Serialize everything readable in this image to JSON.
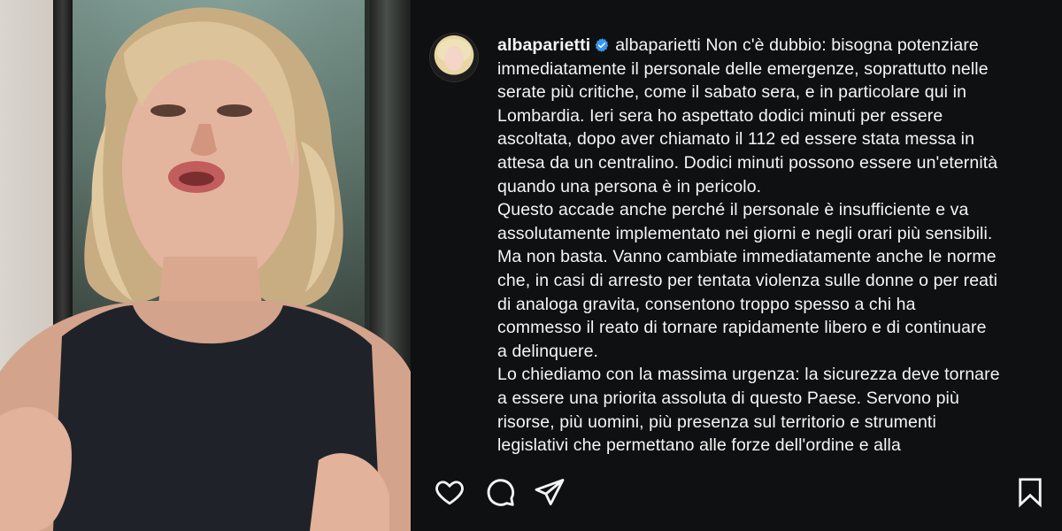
{
  "post": {
    "username": "albaparietti",
    "verified": true,
    "caption_username": "albaparietti",
    "caption_lines": [
      "Non c'è dubbio: bisogna potenziare",
      "immediatamente il personale delle emergenze, soprattutto nelle",
      "serate più critiche, come il sabato sera, e in particolare qui in",
      "Lombardia. Ieri sera ho aspettato dodici minuti per essere",
      "ascoltata, dopo aver chiamato il 112 ed essere stata messa in",
      "attesa da un centralino. Dodici minuti possono essere un'eternità",
      "quando una persona è in pericolo.",
      "Questo accade anche perché il personale è insufficiente e va",
      "assolutamente implementato nei giorni e negli orari più sensibili.",
      "Ma non basta. Vanno cambiate immediatamente anche le norme",
      "che, in casi di arresto per tentata violenza sulle donne o per reati",
      "di analoga gravita, consentono troppo spesso a chi ha",
      "commesso il reato di tornare rapidamente libero e di continuare",
      "a delinquere.",
      "Lo chiediamo con la massima urgenza: la sicurezza deve tornare",
      "a essere una priorita assoluta di questo Paese. Servono più",
      "risorse, più uomini, più presenza sul territorio e strumenti",
      "legislativi che permettano alle forze dell'ordine e alla"
    ]
  },
  "actions": {
    "like": "heart-icon",
    "comment": "comment-icon",
    "share": "send-icon",
    "save": "bookmark-icon"
  },
  "colors": {
    "panel_bg": "#0f1011",
    "text": "#f5f5f5",
    "verified": "#3897f0"
  }
}
